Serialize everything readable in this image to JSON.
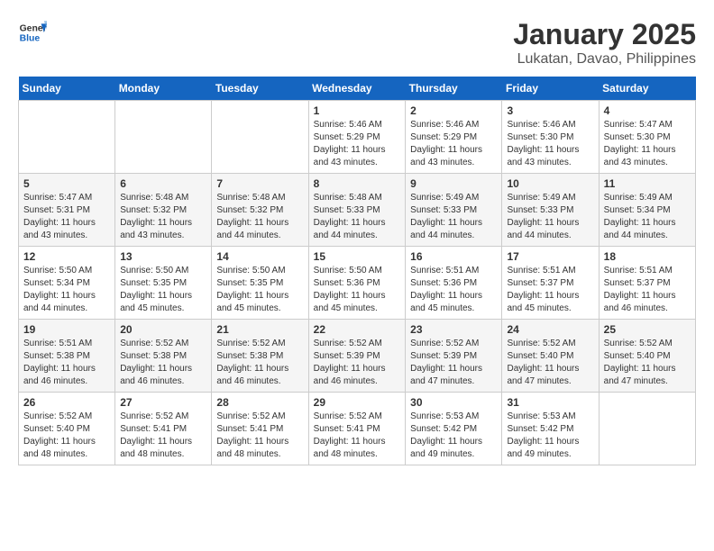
{
  "header": {
    "logo_line1": "General",
    "logo_line2": "Blue",
    "month_year": "January 2025",
    "location": "Lukatan, Davao, Philippines"
  },
  "weekdays": [
    "Sunday",
    "Monday",
    "Tuesday",
    "Wednesday",
    "Thursday",
    "Friday",
    "Saturday"
  ],
  "weeks": [
    [
      {
        "day": "",
        "info": ""
      },
      {
        "day": "",
        "info": ""
      },
      {
        "day": "",
        "info": ""
      },
      {
        "day": "1",
        "info": "Sunrise: 5:46 AM\nSunset: 5:29 PM\nDaylight: 11 hours\nand 43 minutes."
      },
      {
        "day": "2",
        "info": "Sunrise: 5:46 AM\nSunset: 5:29 PM\nDaylight: 11 hours\nand 43 minutes."
      },
      {
        "day": "3",
        "info": "Sunrise: 5:46 AM\nSunset: 5:30 PM\nDaylight: 11 hours\nand 43 minutes."
      },
      {
        "day": "4",
        "info": "Sunrise: 5:47 AM\nSunset: 5:30 PM\nDaylight: 11 hours\nand 43 minutes."
      }
    ],
    [
      {
        "day": "5",
        "info": "Sunrise: 5:47 AM\nSunset: 5:31 PM\nDaylight: 11 hours\nand 43 minutes."
      },
      {
        "day": "6",
        "info": "Sunrise: 5:48 AM\nSunset: 5:32 PM\nDaylight: 11 hours\nand 43 minutes."
      },
      {
        "day": "7",
        "info": "Sunrise: 5:48 AM\nSunset: 5:32 PM\nDaylight: 11 hours\nand 44 minutes."
      },
      {
        "day": "8",
        "info": "Sunrise: 5:48 AM\nSunset: 5:33 PM\nDaylight: 11 hours\nand 44 minutes."
      },
      {
        "day": "9",
        "info": "Sunrise: 5:49 AM\nSunset: 5:33 PM\nDaylight: 11 hours\nand 44 minutes."
      },
      {
        "day": "10",
        "info": "Sunrise: 5:49 AM\nSunset: 5:33 PM\nDaylight: 11 hours\nand 44 minutes."
      },
      {
        "day": "11",
        "info": "Sunrise: 5:49 AM\nSunset: 5:34 PM\nDaylight: 11 hours\nand 44 minutes."
      }
    ],
    [
      {
        "day": "12",
        "info": "Sunrise: 5:50 AM\nSunset: 5:34 PM\nDaylight: 11 hours\nand 44 minutes."
      },
      {
        "day": "13",
        "info": "Sunrise: 5:50 AM\nSunset: 5:35 PM\nDaylight: 11 hours\nand 45 minutes."
      },
      {
        "day": "14",
        "info": "Sunrise: 5:50 AM\nSunset: 5:35 PM\nDaylight: 11 hours\nand 45 minutes."
      },
      {
        "day": "15",
        "info": "Sunrise: 5:50 AM\nSunset: 5:36 PM\nDaylight: 11 hours\nand 45 minutes."
      },
      {
        "day": "16",
        "info": "Sunrise: 5:51 AM\nSunset: 5:36 PM\nDaylight: 11 hours\nand 45 minutes."
      },
      {
        "day": "17",
        "info": "Sunrise: 5:51 AM\nSunset: 5:37 PM\nDaylight: 11 hours\nand 45 minutes."
      },
      {
        "day": "18",
        "info": "Sunrise: 5:51 AM\nSunset: 5:37 PM\nDaylight: 11 hours\nand 46 minutes."
      }
    ],
    [
      {
        "day": "19",
        "info": "Sunrise: 5:51 AM\nSunset: 5:38 PM\nDaylight: 11 hours\nand 46 minutes."
      },
      {
        "day": "20",
        "info": "Sunrise: 5:52 AM\nSunset: 5:38 PM\nDaylight: 11 hours\nand 46 minutes."
      },
      {
        "day": "21",
        "info": "Sunrise: 5:52 AM\nSunset: 5:38 PM\nDaylight: 11 hours\nand 46 minutes."
      },
      {
        "day": "22",
        "info": "Sunrise: 5:52 AM\nSunset: 5:39 PM\nDaylight: 11 hours\nand 46 minutes."
      },
      {
        "day": "23",
        "info": "Sunrise: 5:52 AM\nSunset: 5:39 PM\nDaylight: 11 hours\nand 47 minutes."
      },
      {
        "day": "24",
        "info": "Sunrise: 5:52 AM\nSunset: 5:40 PM\nDaylight: 11 hours\nand 47 minutes."
      },
      {
        "day": "25",
        "info": "Sunrise: 5:52 AM\nSunset: 5:40 PM\nDaylight: 11 hours\nand 47 minutes."
      }
    ],
    [
      {
        "day": "26",
        "info": "Sunrise: 5:52 AM\nSunset: 5:40 PM\nDaylight: 11 hours\nand 48 minutes."
      },
      {
        "day": "27",
        "info": "Sunrise: 5:52 AM\nSunset: 5:41 PM\nDaylight: 11 hours\nand 48 minutes."
      },
      {
        "day": "28",
        "info": "Sunrise: 5:52 AM\nSunset: 5:41 PM\nDaylight: 11 hours\nand 48 minutes."
      },
      {
        "day": "29",
        "info": "Sunrise: 5:52 AM\nSunset: 5:41 PM\nDaylight: 11 hours\nand 48 minutes."
      },
      {
        "day": "30",
        "info": "Sunrise: 5:53 AM\nSunset: 5:42 PM\nDaylight: 11 hours\nand 49 minutes."
      },
      {
        "day": "31",
        "info": "Sunrise: 5:53 AM\nSunset: 5:42 PM\nDaylight: 11 hours\nand 49 minutes."
      },
      {
        "day": "",
        "info": ""
      }
    ]
  ]
}
